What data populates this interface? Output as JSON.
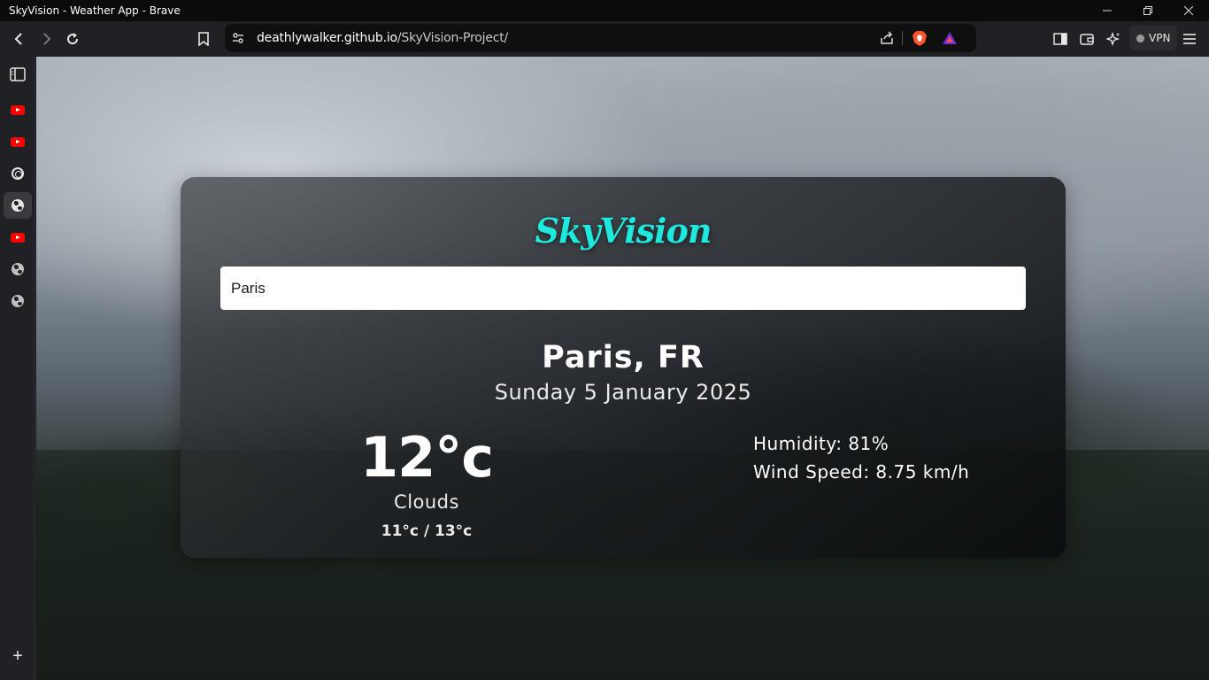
{
  "window": {
    "title": "SkyVision - Weather App - Brave",
    "minimize_icon": "minimize-icon",
    "restore_icon": "restore-icon",
    "close_icon": "close-icon"
  },
  "toolbar": {
    "url_host": "deathlywalker.github.io",
    "url_path": "/SkyVision-Project/",
    "vpn_label": "VPN"
  },
  "sidebar": {
    "items": [
      {
        "name": "sidebar-panel-icon"
      },
      {
        "name": "youtube-icon"
      },
      {
        "name": "youtube-icon"
      },
      {
        "name": "chatgpt-icon"
      },
      {
        "name": "globe-icon",
        "active": true
      },
      {
        "name": "youtube-icon"
      },
      {
        "name": "globe-icon"
      },
      {
        "name": "globe-icon"
      }
    ],
    "add_label": "+"
  },
  "app": {
    "logo": "SkyVision",
    "accent_color": "#1de9dd",
    "search_value": "Paris",
    "city": "Paris, FR",
    "date": "Sunday 5 January 2025",
    "temperature": "12°c",
    "condition": "Clouds",
    "range": "11°c / 13°c",
    "humidity_label": "Humidity: ",
    "humidity_value": "81%",
    "wind_label": "Wind Speed: ",
    "wind_value": "8.75 km/h"
  }
}
